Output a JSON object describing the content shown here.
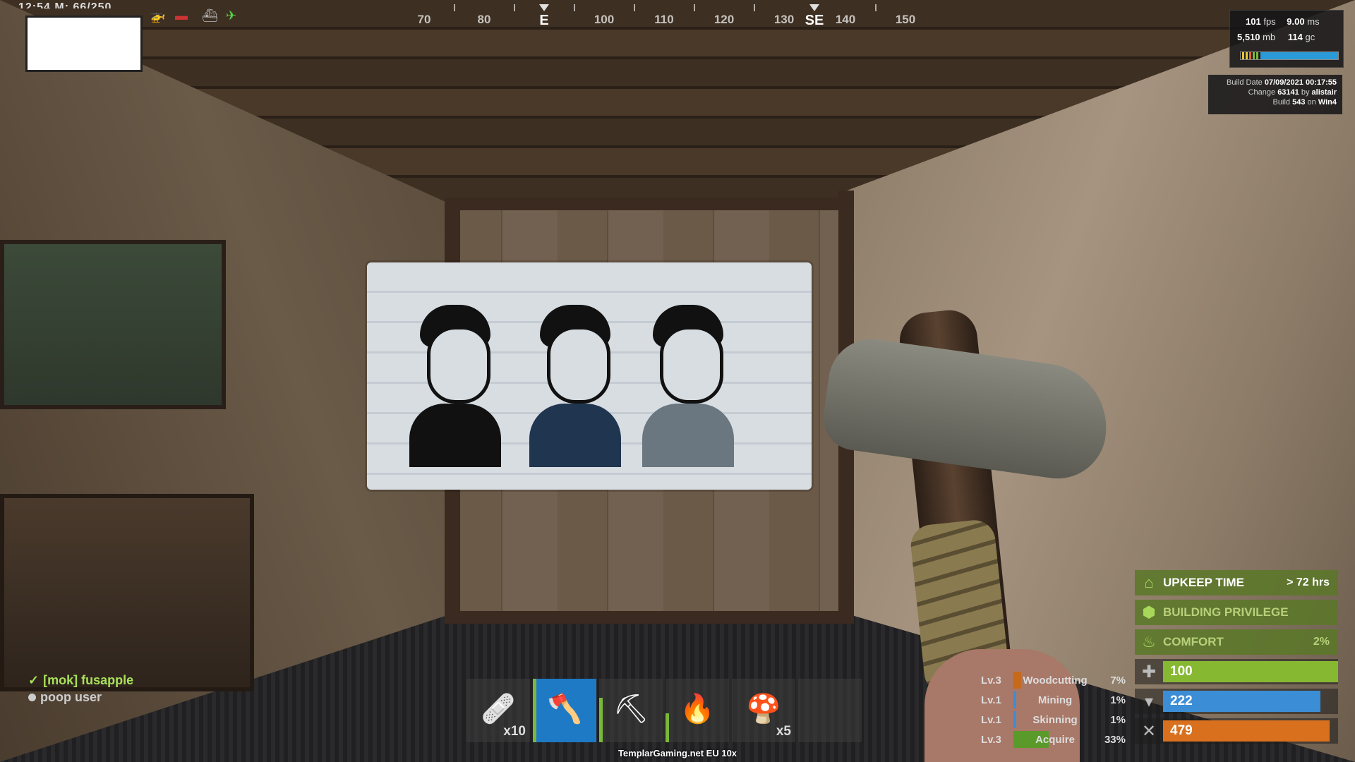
{
  "compass": {
    "labels": [
      "70",
      "80",
      "E",
      "100",
      "110",
      "120",
      "130",
      "SE",
      "140",
      "150"
    ]
  },
  "top_left": {
    "clock_text": "12:54  M: 66/250"
  },
  "perf": {
    "fps_value": "101",
    "fps_unit": "fps",
    "ms_value": "9.00",
    "ms_unit": "ms",
    "mb_value": "5,510",
    "mb_unit": "mb",
    "gc_value": "114",
    "gc_unit": "gc"
  },
  "build_info": {
    "date_label": "Build Date",
    "date_value": "07/09/2021 00:17:55",
    "change_label": "Change",
    "change_value": "63141",
    "change_by_label": "by",
    "change_by_value": "alistair",
    "build_label": "Build",
    "build_value": "543",
    "build_on_label": "on",
    "build_on_value": "Win4"
  },
  "status": {
    "upkeep_label": "UPKEEP TIME",
    "upkeep_value": "> 72 hrs",
    "privilege_label": "BUILDING PRIVILEGE",
    "comfort_label": "COMFORT",
    "comfort_value": "2%"
  },
  "vitals": {
    "health": {
      "value": "100",
      "fill": 1.0,
      "color": "#86b832"
    },
    "hydration": {
      "value": "222",
      "fill": 0.9,
      "color": "#3b8ed6"
    },
    "calories": {
      "value": "479",
      "fill": 0.95,
      "color": "#d8701e"
    }
  },
  "skills": [
    {
      "level": "Lv.3",
      "name": "Woodcutting",
      "percent": "7%",
      "fill": 0.07,
      "color": "#c66a1a"
    },
    {
      "level": "Lv.1",
      "name": "Mining",
      "percent": "1%",
      "fill": 0.01,
      "color": "#3b8ed6"
    },
    {
      "level": "Lv.1",
      "name": "Skinning",
      "percent": "1%",
      "fill": 0.01,
      "color": "#3b8ed6"
    },
    {
      "level": "Lv.3",
      "name": "Acquire",
      "percent": "33%",
      "fill": 0.33,
      "color": "#5a9a2a"
    }
  ],
  "hotbar": [
    {
      "icon": "bandage-icon",
      "glyph": "🩹",
      "qty": "x10",
      "active": false,
      "condition": 0
    },
    {
      "icon": "stone-hatchet-icon",
      "glyph": "🪓",
      "qty": "",
      "active": true,
      "condition": 1.0
    },
    {
      "icon": "stone-pickaxe-icon",
      "glyph": "⛏",
      "qty": "",
      "active": false,
      "condition": 0.7
    },
    {
      "icon": "torch-icon",
      "glyph": "🔥",
      "qty": "",
      "active": false,
      "condition": 0.45
    },
    {
      "icon": "mushroom-icon",
      "glyph": "🍄",
      "qty": "x5",
      "active": false,
      "condition": 0
    },
    {
      "icon": "empty-slot",
      "glyph": "",
      "qty": "",
      "active": false,
      "condition": 0
    }
  ],
  "server_name": "TemplarGaming.net EU 10x",
  "team": [
    {
      "name": "[mok] fusapple",
      "status": "leader"
    },
    {
      "name": "poop user",
      "status": "member"
    }
  ]
}
